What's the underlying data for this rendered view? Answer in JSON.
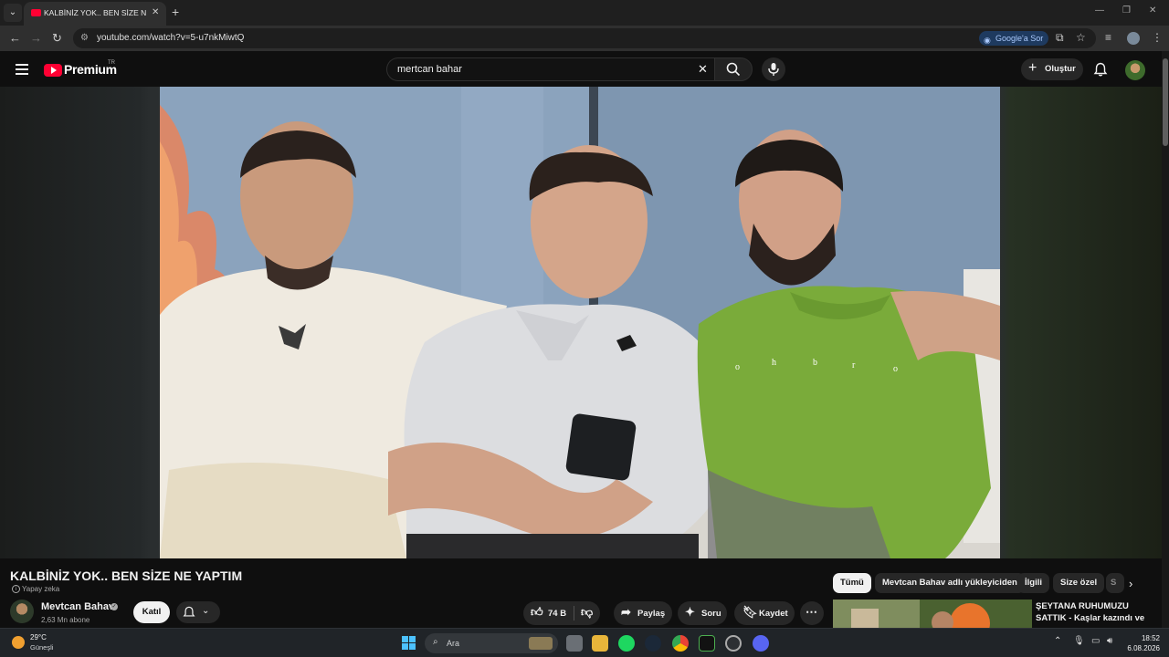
{
  "browser": {
    "tab_title": "KALBİNİZ YOK.. BEN SİZE NE YAPTIM",
    "url": "youtube.com/watch?v=5-u7nkMiwtQ",
    "google_button": "Google'a Sor",
    "icons": [
      "tab-menu-icon",
      "new-tab-icon",
      "back-icon",
      "forward-icon",
      "reload-icon",
      "site-info-icon",
      "install-icon",
      "bookmark-star-icon",
      "reading-list-icon",
      "profile-icon",
      "menu-dots-icon",
      "minimize-icon",
      "restore-icon",
      "close-icon"
    ]
  },
  "header": {
    "logo_text": "Premium",
    "logo_country": "TR",
    "search_value": "mertcan bahar",
    "create_label": "Oluştur"
  },
  "video": {
    "title": "KALBİNİZ YOK.. BEN SİZE NE YAPTIM",
    "ai_badge": "Yapay zeka",
    "channel_name": "Mevtcan Bahav",
    "subscribers": "2,63 Mn abone",
    "join_label": "Katıl",
    "like_count": "74 B",
    "share_label": "Paylaş",
    "ask_label": "Soru",
    "save_label": "Kaydet"
  },
  "chips": [
    {
      "label": "Tümü",
      "active": true
    },
    {
      "label": "Mevtcan Bahav adlı yükleyiciden",
      "active": false
    },
    {
      "label": "İlgili",
      "active": false
    },
    {
      "label": "Size özel",
      "active": false
    },
    {
      "label": "S",
      "active": false
    }
  ],
  "related": {
    "title": "ŞEYTANA RUHUMUZU SATTIK - Kaşlar kazındı ve"
  },
  "taskbar": {
    "temperature": "29°C",
    "weather": "Güneşli",
    "search_label": "Ara",
    "time": "18:52",
    "date": "6.08.2026"
  },
  "colors": {
    "youtube_red": "#ff0033",
    "page_bg": "#0f0f0f",
    "chip_bg": "#272727",
    "taskbar_bg": "#202428"
  }
}
